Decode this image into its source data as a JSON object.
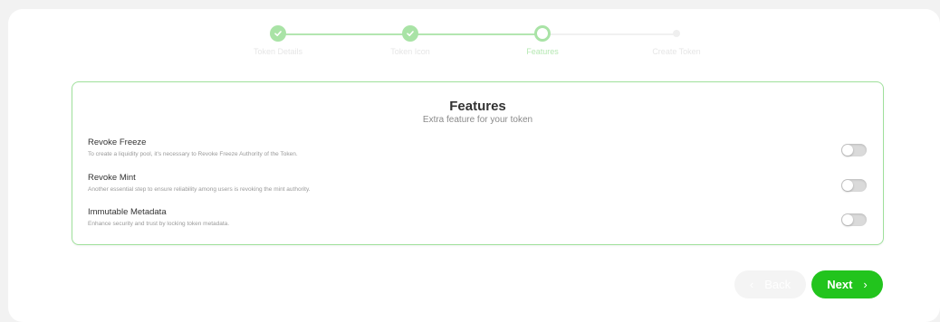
{
  "stepper": {
    "steps": [
      {
        "label": "Token Details",
        "state": "done"
      },
      {
        "label": "Token Icon",
        "state": "done"
      },
      {
        "label": "Features",
        "state": "current"
      },
      {
        "label": "Create Token",
        "state": "todo"
      }
    ],
    "check_icon": "check-icon"
  },
  "features": {
    "title": "Features",
    "subtitle": "Extra feature for your token",
    "items": [
      {
        "name": "Revoke Freeze",
        "description": "To create a liquidity pool, it's necessary to Revoke Freeze Authority of the Token.",
        "enabled": false
      },
      {
        "name": "Revoke Mint",
        "description": "Another essential step to ensure reliability among users is revoking the mint authority.",
        "enabled": false
      },
      {
        "name": "Immutable Metadata",
        "description": "Enhance security and trust by locking token metadata.",
        "enabled": false
      }
    ]
  },
  "navigation": {
    "back_label": "Back",
    "next_label": "Next",
    "back_icon": "chevron-left-icon",
    "next_icon": "chevron-right-icon"
  },
  "colors": {
    "accent": "#22c41d",
    "accent_light": "#a9e3a6",
    "panel_border": "#9fe09b"
  }
}
